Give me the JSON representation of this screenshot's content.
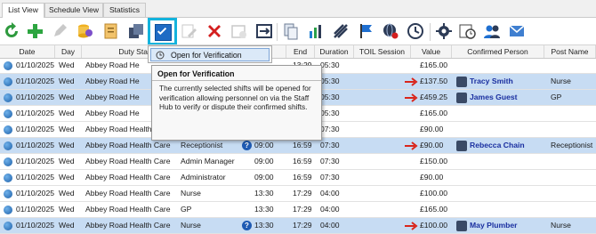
{
  "tabs": [
    "List View",
    "Schedule View",
    "Statistics"
  ],
  "toolbar": {
    "icons": [
      "refresh-icon",
      "add-icon",
      "edit-icon",
      "database-export-icon",
      "duty-icon",
      "copy-icon",
      "verify-check-icon",
      "form-edit-icon",
      "delete-icon",
      "calendar-icon",
      "swap-icon",
      "documents-icon",
      "chart-icon",
      "pattern-icon",
      "flag-icon",
      "globe-network-icon",
      "clock-icon",
      "gear-icon",
      "schedule-icon",
      "users-icon",
      "email-icon"
    ]
  },
  "columns": {
    "date": "Date",
    "day": "Day",
    "duty_station": "Duty Station",
    "end": "End",
    "duration": "Duration",
    "toil": "TOIL Session",
    "value": "Value",
    "confirmed_person": "Confirmed Person",
    "post_name": "Post Name"
  },
  "rows": [
    {
      "date": "01/10/2025",
      "day": "Wed",
      "station": "Abbey Road He",
      "role": "",
      "start": "",
      "end": "13:29",
      "duration": "05:30",
      "toil": "",
      "value": "£165.00",
      "person": "",
      "post": "",
      "selected": false,
      "arrow": false,
      "q": false
    },
    {
      "date": "01/10/2025",
      "day": "Wed",
      "station": "Abbey Road He",
      "role": "",
      "start": "",
      "end": "",
      "duration": "05:30",
      "toil": "",
      "value": "£137.50",
      "person": "Tracy Smith",
      "post": "Nurse",
      "selected": true,
      "arrow": true,
      "q": false
    },
    {
      "date": "01/10/2025",
      "day": "Wed",
      "station": "Abbey Road He",
      "role": "",
      "start": "",
      "end": "",
      "duration": "05:30",
      "toil": "",
      "value": "£459.25",
      "person": "James Guest",
      "post": "GP",
      "selected": true,
      "arrow": true,
      "q": false
    },
    {
      "date": "01/10/2025",
      "day": "Wed",
      "station": "Abbey Road He",
      "role": "",
      "start": "",
      "end": "",
      "duration": "05:30",
      "toil": "",
      "value": "£165.00",
      "person": "",
      "post": "",
      "selected": false,
      "arrow": false,
      "q": false
    },
    {
      "date": "01/10/2025",
      "day": "Wed",
      "station": "Abbey Road Health Care",
      "role": "Receptionist",
      "start": "08:00",
      "end": "15:59",
      "duration": "07:30",
      "toil": "",
      "value": "£90.00",
      "person": "",
      "post": "",
      "selected": false,
      "arrow": false,
      "q": false
    },
    {
      "date": "01/10/2025",
      "day": "Wed",
      "station": "Abbey Road Health Care",
      "role": "Receptionist",
      "start": "09:00",
      "end": "16:59",
      "duration": "07:30",
      "toil": "",
      "value": "£90.00",
      "person": "Rebecca Chain",
      "post": "Receptionist",
      "selected": true,
      "arrow": true,
      "q": true
    },
    {
      "date": "01/10/2025",
      "day": "Wed",
      "station": "Abbey Road Health Care",
      "role": "Admin Manager",
      "start": "09:00",
      "end": "16:59",
      "duration": "07:30",
      "toil": "",
      "value": "£150.00",
      "person": "",
      "post": "",
      "selected": false,
      "arrow": false,
      "q": false
    },
    {
      "date": "01/10/2025",
      "day": "Wed",
      "station": "Abbey Road Health Care",
      "role": "Administrator",
      "start": "09:00",
      "end": "16:59",
      "duration": "07:30",
      "toil": "",
      "value": "£90.00",
      "person": "",
      "post": "",
      "selected": false,
      "arrow": false,
      "q": false
    },
    {
      "date": "01/10/2025",
      "day": "Wed",
      "station": "Abbey Road Health Care",
      "role": "Nurse",
      "start": "13:30",
      "end": "17:29",
      "duration": "04:00",
      "toil": "",
      "value": "£100.00",
      "person": "",
      "post": "",
      "selected": false,
      "arrow": false,
      "q": false
    },
    {
      "date": "01/10/2025",
      "day": "Wed",
      "station": "Abbey Road Health Care",
      "role": "GP",
      "start": "13:30",
      "end": "17:29",
      "duration": "04:00",
      "toil": "",
      "value": "£165.00",
      "person": "",
      "post": "",
      "selected": false,
      "arrow": false,
      "q": false
    },
    {
      "date": "01/10/2025",
      "day": "Wed",
      "station": "Abbey Road Health Care",
      "role": "Nurse",
      "start": "13:30",
      "end": "17:29",
      "duration": "04:00",
      "toil": "",
      "value": "£100.00",
      "person": "May Plumber",
      "post": "Nurse",
      "selected": true,
      "arrow": true,
      "q": true
    }
  ],
  "context_menu": {
    "item": "Open for Verification"
  },
  "tooltip": {
    "title": "Open for Verification",
    "body": "The currently selected shifts will be opened for verification allowing personnel on via the Staff Hub to verify or dispute their confirmed shifts."
  },
  "colors": {
    "highlight_frame": "#13b3dd",
    "selected_row": "#c7dcf3",
    "arrow": "#d9261c",
    "person_name": "#1a2fa0"
  }
}
